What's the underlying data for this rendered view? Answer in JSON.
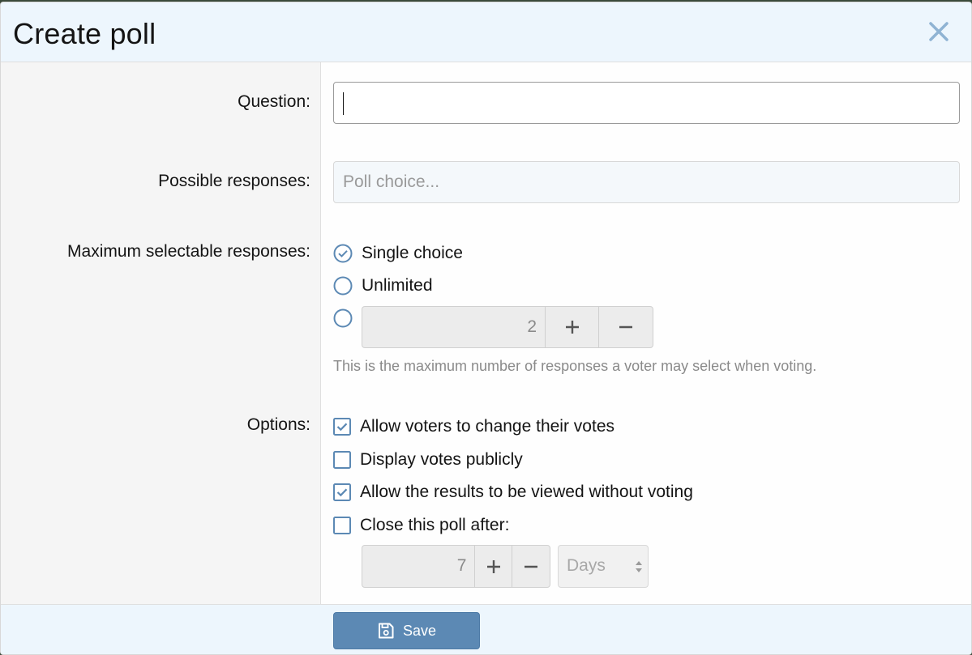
{
  "dialog": {
    "title": "Create poll"
  },
  "question": {
    "label": "Question:",
    "value": ""
  },
  "responses": {
    "label": "Possible responses:",
    "placeholder": "Poll choice..."
  },
  "max_responses": {
    "label": "Maximum selectable responses:",
    "options": [
      {
        "label": "Single choice",
        "selected": true
      },
      {
        "label": "Unlimited",
        "selected": false
      },
      {
        "label": "",
        "selected": false
      }
    ],
    "custom_value": "2",
    "hint": "This is the maximum number of responses a voter may select when voting."
  },
  "options": {
    "label": "Options:",
    "items": [
      {
        "label": "Allow voters to change their votes",
        "checked": true
      },
      {
        "label": "Display votes publicly",
        "checked": false
      },
      {
        "label": "Allow the results to be viewed without voting",
        "checked": true
      },
      {
        "label": "Close this poll after:",
        "checked": false
      }
    ],
    "close_after_value": "7",
    "close_after_unit": "Days"
  },
  "footer": {
    "save_label": "Save"
  },
  "colors": {
    "accent": "#5c89b4",
    "header_bg": "#edf6fd",
    "label_bg": "#f5f5f5"
  }
}
